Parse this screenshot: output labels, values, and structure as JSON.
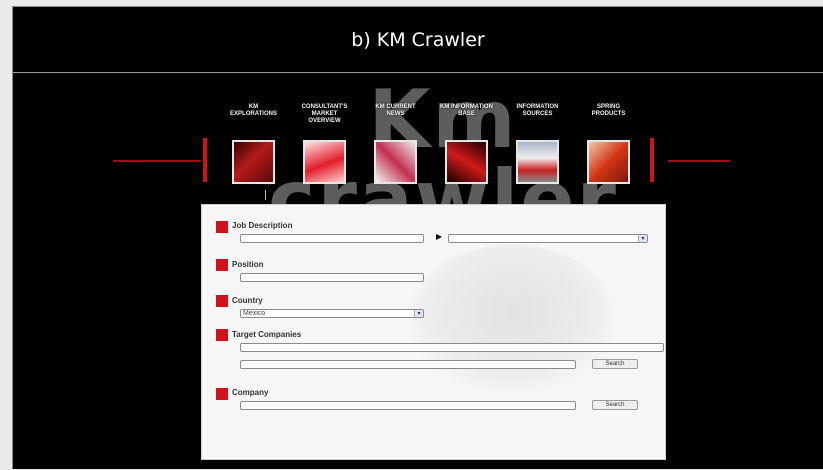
{
  "caption": "b) KM Crawler",
  "logo": "Km crawler",
  "colors": {
    "accent": "#d0121b",
    "background": "#000000",
    "panel": "#f6f6f6"
  },
  "nav_items": [
    {
      "label": "KM EXPLORATIONS",
      "thumb_color": "#9a1a1a",
      "icon": "red-objects-thumb"
    },
    {
      "label": "CONSULTANT'S MARKET OVERVIEW",
      "thumb_color": "#e8a2a2",
      "icon": "red-ribbon-thumb"
    },
    {
      "label": "KM CURRENT NEWS",
      "thumb_color": "#c43050",
      "icon": "phone-thumb"
    },
    {
      "label": "KM INFORMATION BASE",
      "thumb_color": "#7a0d0d",
      "icon": "red-glow-thumb"
    },
    {
      "label": "INFORMATION SOURCES",
      "thumb_color": "#b8b8c8",
      "icon": "basket-thumb"
    },
    {
      "label": "SPRING PRODUCTS",
      "thumb_color": "#c53d1e",
      "icon": "fruit-thumb"
    }
  ],
  "form": {
    "job_description": {
      "label": "Job Description",
      "value": "",
      "select_value": ""
    },
    "position": {
      "label": "Position",
      "value": ""
    },
    "country": {
      "label": "Country",
      "selected": "Mexico"
    },
    "target_companies": {
      "label": "Target Companies",
      "value1": "",
      "value2": "",
      "search_label": "Search"
    },
    "company": {
      "label": "Company",
      "value": "",
      "search_label": "Search"
    }
  }
}
